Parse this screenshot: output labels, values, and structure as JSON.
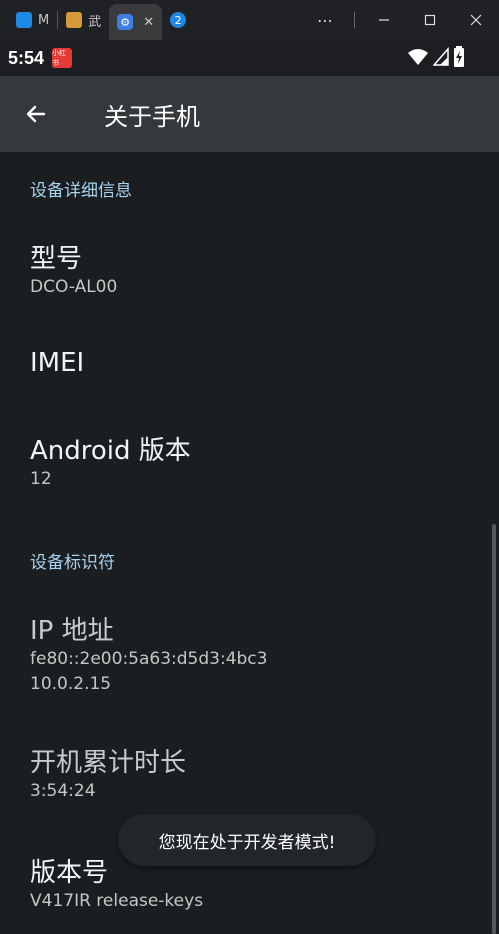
{
  "browser": {
    "tabs": [
      {
        "label": "M",
        "icon": "maps-app-icon"
      },
      {
        "label": "武",
        "icon": "game-avatar-icon"
      },
      {
        "label": "",
        "icon": "settings-gear-icon",
        "active": true
      }
    ],
    "badge": "2",
    "close_tab": "✕"
  },
  "status": {
    "time": "5:54",
    "notif_label": "小红书"
  },
  "appbar": {
    "title": "关于手机"
  },
  "sections": {
    "device_details": "设备详细信息",
    "device_identifiers": "设备标识符"
  },
  "items": {
    "model": {
      "title": "型号",
      "value": "DCO-AL00"
    },
    "imei": {
      "title": "IMEI"
    },
    "android": {
      "title": "Android 版本",
      "value": "12"
    },
    "ip": {
      "title": "IP 地址",
      "value1": "fe80::2e00:5a63:d5d3:4bc3",
      "value2": "10.0.2.15"
    },
    "uptime": {
      "title": "开机累计时长",
      "value": "3:54:24"
    },
    "build": {
      "title": "版本号",
      "value": "V417IR release-keys"
    }
  },
  "toast": "您现在处于开发者模式!",
  "colors": {
    "background": "#1b1e21",
    "appbar": "#36393c",
    "section_header": "#a8d4f0"
  }
}
